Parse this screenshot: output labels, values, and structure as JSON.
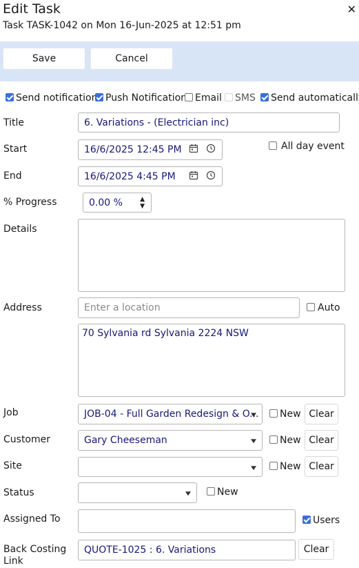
{
  "dialog": {
    "title": "Edit Task",
    "subtitle": "Task TASK-1042 on Mon 16-Jun-2025 at 12:51 pm",
    "close_icon": "close-icon"
  },
  "toolbar": {
    "save_label": "Save",
    "cancel_label": "Cancel"
  },
  "notify": {
    "send_notification": {
      "label": "Send notification",
      "checked": true
    },
    "push_notification": {
      "label": "Push Notification",
      "checked": true
    },
    "email": {
      "label": "Email",
      "checked": false
    },
    "sms": {
      "label": "SMS",
      "checked": false,
      "disabled": true
    },
    "send_automatically": {
      "label": "Send automatically",
      "checked": true
    }
  },
  "form": {
    "title": {
      "label": "Title",
      "value": "6. Variations - (Electrician inc)"
    },
    "start": {
      "label": "Start",
      "value": "16/6/2025 12:45 PM"
    },
    "all_day": {
      "label": "All day event",
      "checked": false
    },
    "end": {
      "label": "End",
      "value": "16/6/2025 4:45 PM"
    },
    "progress": {
      "label": "% Progress",
      "value": "0.00 %"
    },
    "details": {
      "label": "Details",
      "value": ""
    },
    "address": {
      "label": "Address",
      "placeholder": "Enter a location",
      "auto_label": "Auto",
      "auto_checked": false,
      "full_address": "70 Sylvania rd Sylvania 2224 NSW"
    },
    "job": {
      "label": "Job",
      "value": "JOB-04 - Full Garden Redesign & O...",
      "new_label": "New",
      "clear_label": "Clear"
    },
    "customer": {
      "label": "Customer",
      "value": "Gary Cheeseman",
      "new_label": "New",
      "clear_label": "Clear"
    },
    "site": {
      "label": "Site",
      "value": "",
      "new_label": "New",
      "clear_label": "Clear"
    },
    "status": {
      "label": "Status",
      "value": "",
      "new_label": "New"
    },
    "assigned_to": {
      "label": "Assigned To",
      "value": "",
      "users_label": "Users",
      "users_checked": true
    },
    "back_costing": {
      "label": "Back Costing Link",
      "value": "QUOTE-1025 : 6. Variations",
      "clear_label": "Clear"
    }
  },
  "colors": {
    "toolbar_bg": "#d8e5f6",
    "checkbox_accent": "#3b6fd8",
    "field_text": "#17177a"
  }
}
